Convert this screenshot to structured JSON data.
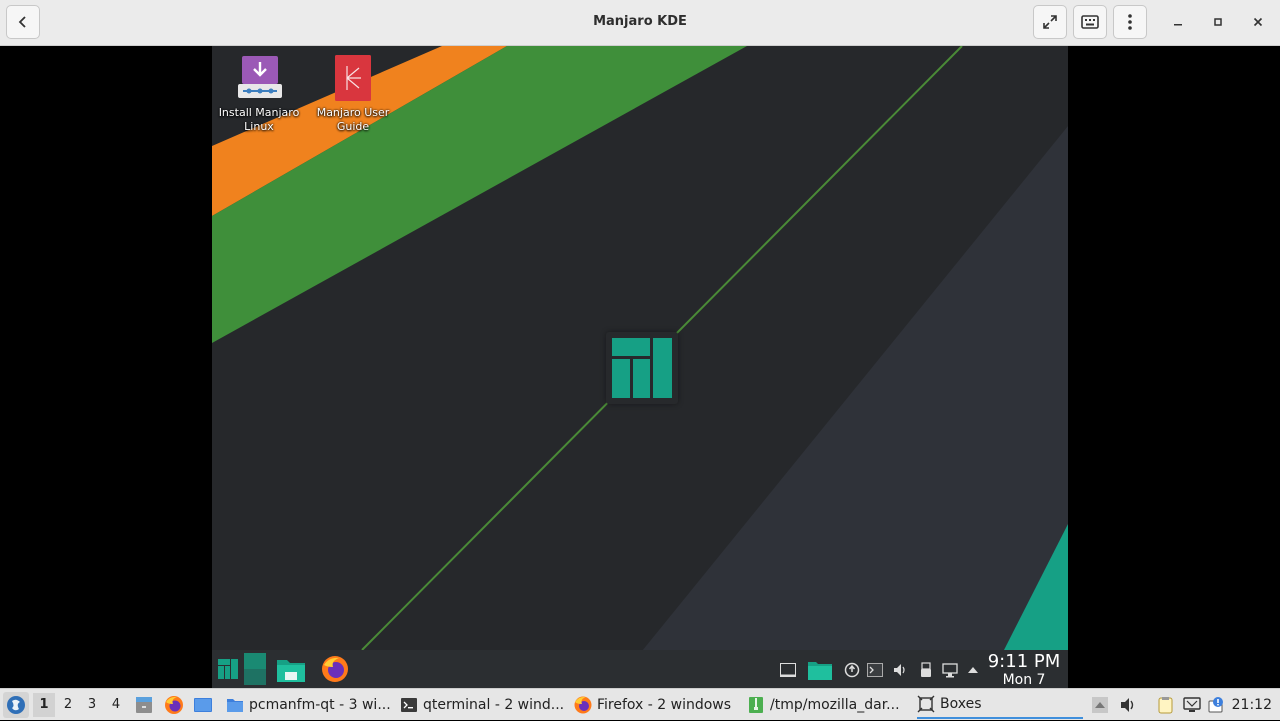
{
  "window": {
    "title": "Manjaro KDE"
  },
  "header": {
    "icons": [
      "go-back-icon",
      "fullscreen-icon",
      "keyboard-icon",
      "menu-kebab-icon",
      "minimize-icon",
      "maximize-icon",
      "close-icon"
    ]
  },
  "guest": {
    "desktop_icons": [
      {
        "label": "Install Manjaro Linux",
        "icon": "installer-icon"
      },
      {
        "label": "Manjaro User Guide",
        "icon": "pdf-document-icon"
      }
    ],
    "panel": {
      "launchers": [
        "manjaro-menu-icon",
        "desktop-pager-icon",
        "file-manager-icon",
        "firefox-icon"
      ],
      "tray_icons": [
        "show-desktop-icon",
        "folder-icon",
        "updates-icon",
        "terminal-icon",
        "volume-icon",
        "usb-device-icon",
        "network-icon",
        "expand-tray-icon"
      ],
      "clock_time": "9:11 PM",
      "clock_date": "Mon 7"
    },
    "colors": {
      "accent_green": "#16a085",
      "stripe_green": "#3f8f3a",
      "stripe_orange": "#f0821e",
      "background": "#26282b"
    }
  },
  "taskbar": {
    "workspaces": [
      "1",
      "2",
      "3",
      "4"
    ],
    "active_workspace": "1",
    "tasks": [
      {
        "label": "pcmanfm-qt - 3 wi...",
        "icon": "folder-icon"
      },
      {
        "label": "qterminal - 2 wind...",
        "icon": "terminal-icon"
      },
      {
        "label": "Firefox - 2 windows",
        "icon": "firefox-icon"
      },
      {
        "label": "/tmp/mozilla_dar...",
        "icon": "archive-icon"
      },
      {
        "label": "Boxes",
        "icon": "boxes-icon",
        "active": true
      }
    ],
    "clock": "21:12"
  }
}
